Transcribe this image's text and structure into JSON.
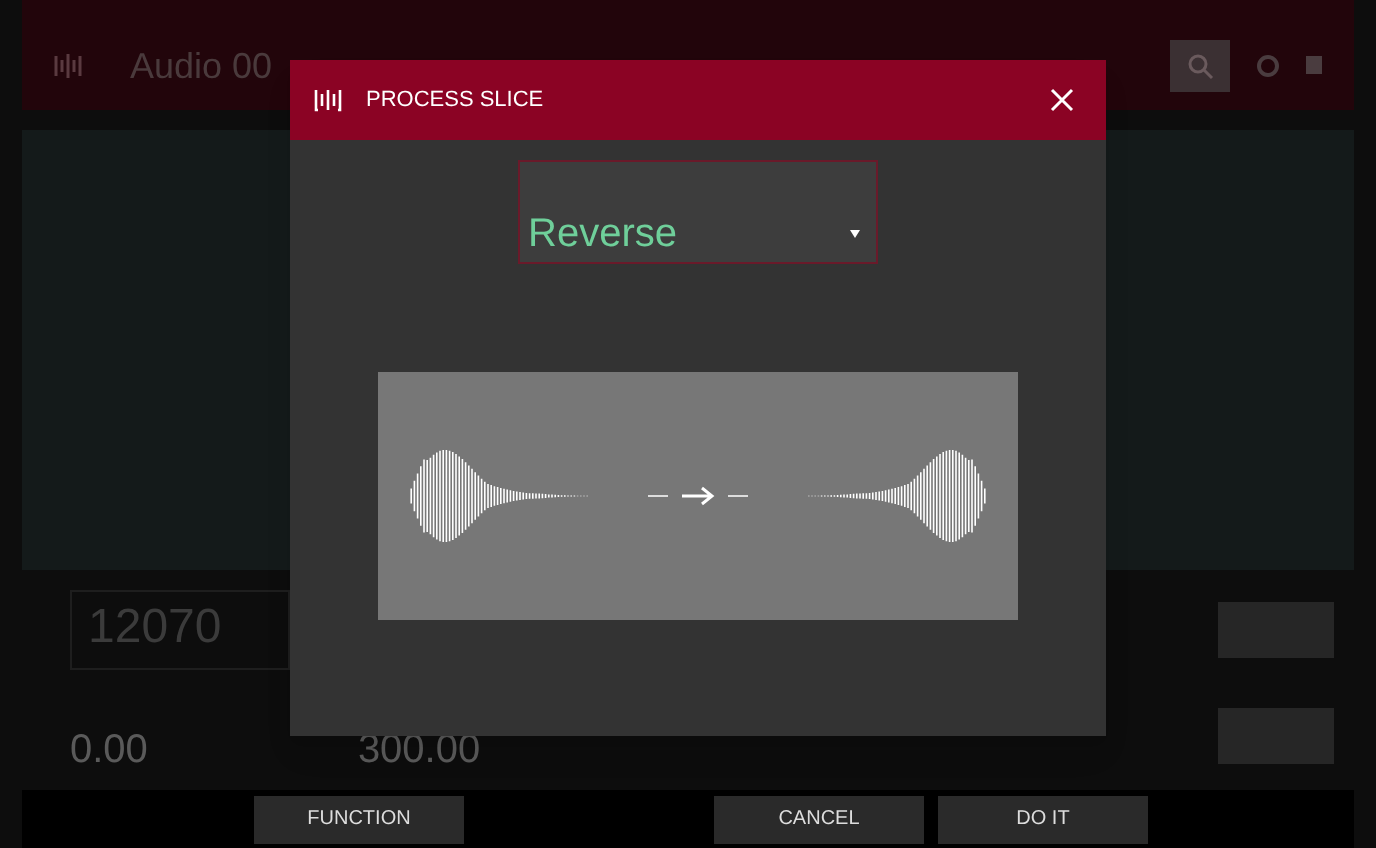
{
  "app_bar": {
    "title": "Audio 00"
  },
  "dialog": {
    "title": "PROCESS SLICE",
    "mode": {
      "value": "Reverse"
    }
  },
  "background_fields": [
    "12070",
    "0.00",
    "300.00"
  ],
  "footer_buttons": [
    "FUNCTION",
    "CANCEL",
    "DO IT"
  ]
}
